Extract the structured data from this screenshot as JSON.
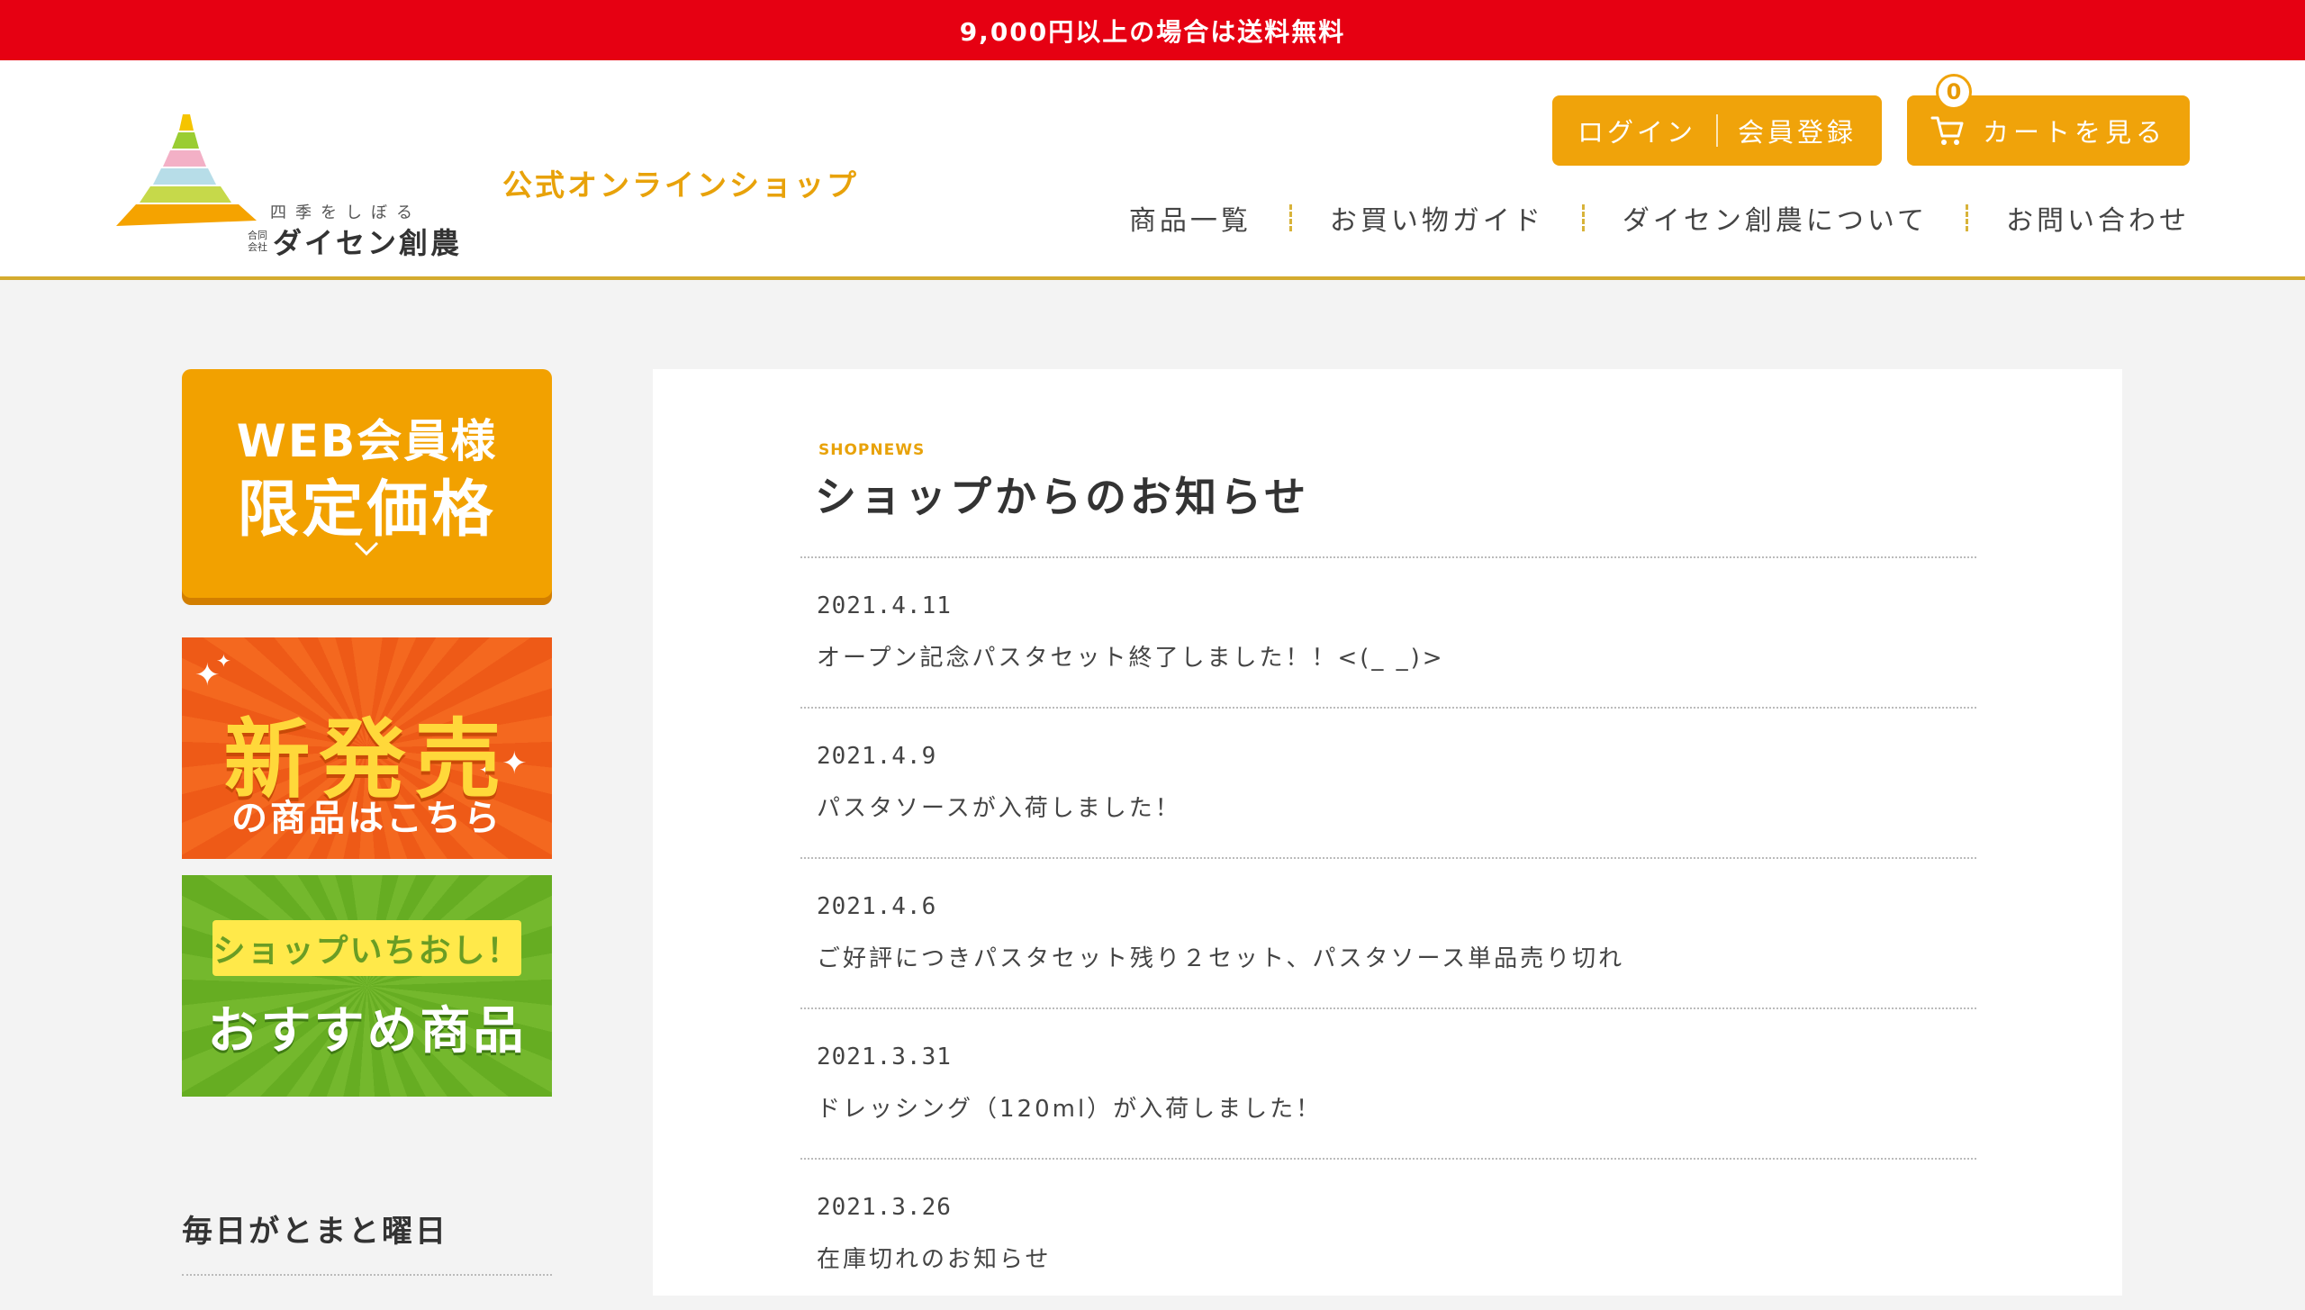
{
  "promo": {
    "text": "9,000円以上の場合は送料無料"
  },
  "header": {
    "tagline": "四季をしぼる",
    "company_prefix": "合同会社",
    "company": "ダイセン創農",
    "shop_title": "公式オンラインショップ",
    "login_label": "ログイン",
    "register_label": "会員登録",
    "cart_label": "カートを見る",
    "cart_count": "0",
    "nav": [
      "商品一覧",
      "お買い物ガイド",
      "ダイセン創農について",
      "お問い合わせ"
    ]
  },
  "sidebar": {
    "member_banner": {
      "line1": "WEB会員様",
      "line2": "限定価格"
    },
    "new_banner": {
      "main": "新発売",
      "sub": "の商品はこちら"
    },
    "recommend_banner": {
      "ribbon": "ショップいちおし！",
      "main": "おすすめ商品"
    },
    "heading": "毎日がとまと曜日"
  },
  "main": {
    "section_label": "SHOPNEWS",
    "section_title": "ショップからのお知らせ",
    "news": [
      {
        "date": "2021.4.11",
        "title": "オープン記念パスタセット終了しました！！<(_ _)>"
      },
      {
        "date": "2021.4.9",
        "title": "パスタソースが入荷しました！"
      },
      {
        "date": "2021.4.6",
        "title": "ご好評につきパスタセット残り２セット、パスタソース単品売り切れ"
      },
      {
        "date": "2021.3.31",
        "title": "ドレッシング（120ml）が入荷しました！"
      },
      {
        "date": "2021.3.26",
        "title": "在庫切れのお知らせ"
      }
    ]
  },
  "colors": {
    "promo_red": "#e60012",
    "accent_orange": "#f0a30a",
    "header_border": "#d4ab2f",
    "new_banner": "#f4681f",
    "recommend_banner": "#74b82d"
  },
  "icons": [
    "logo-mark-icon",
    "cart-icon",
    "chevron-down-icon",
    "sparkle-icon"
  ]
}
